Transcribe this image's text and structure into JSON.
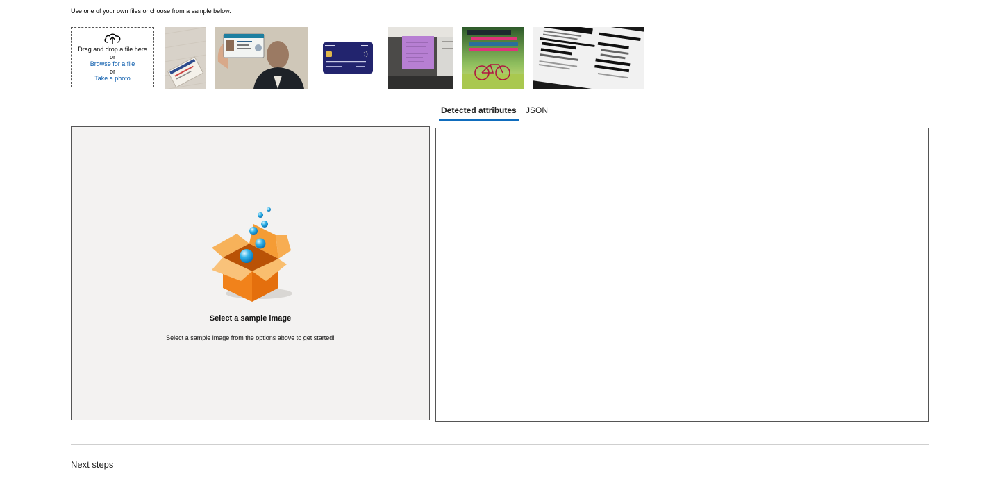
{
  "intro": "Use one of your own files or choose from a sample below.",
  "upload": {
    "drag_text": "Drag and drop a file here",
    "or1": "or",
    "browse_link": "Browse for a file",
    "or2": "or",
    "photo_link": "Take a photo",
    "icon": "cloud-upload-icon"
  },
  "samples": [
    {
      "name": "social-security-card",
      "icon": "id-card-thumbnail"
    },
    {
      "name": "person-holding-id",
      "icon": "photo-thumbnail"
    },
    {
      "name": "credit-card",
      "icon": "credit-card-thumbnail"
    },
    {
      "name": "sticky-note",
      "icon": "note-thumbnail"
    },
    {
      "name": "bicycle-poster",
      "icon": "poster-thumbnail"
    },
    {
      "name": "nutrition-facts",
      "icon": "label-thumbnail"
    }
  ],
  "tabs": {
    "detected": "Detected attributes",
    "json": "JSON"
  },
  "empty_state": {
    "title": "Select a sample image",
    "subtitle": "Select a sample image from the options above to get started!",
    "icon": "open-box-illustration"
  },
  "footer": {
    "next_steps": "Next steps"
  },
  "colors": {
    "accent": "#0f6cbd",
    "link": "#0b5cad",
    "panel_bg": "#f3f2f1",
    "box_orange": "#f39a2e"
  }
}
